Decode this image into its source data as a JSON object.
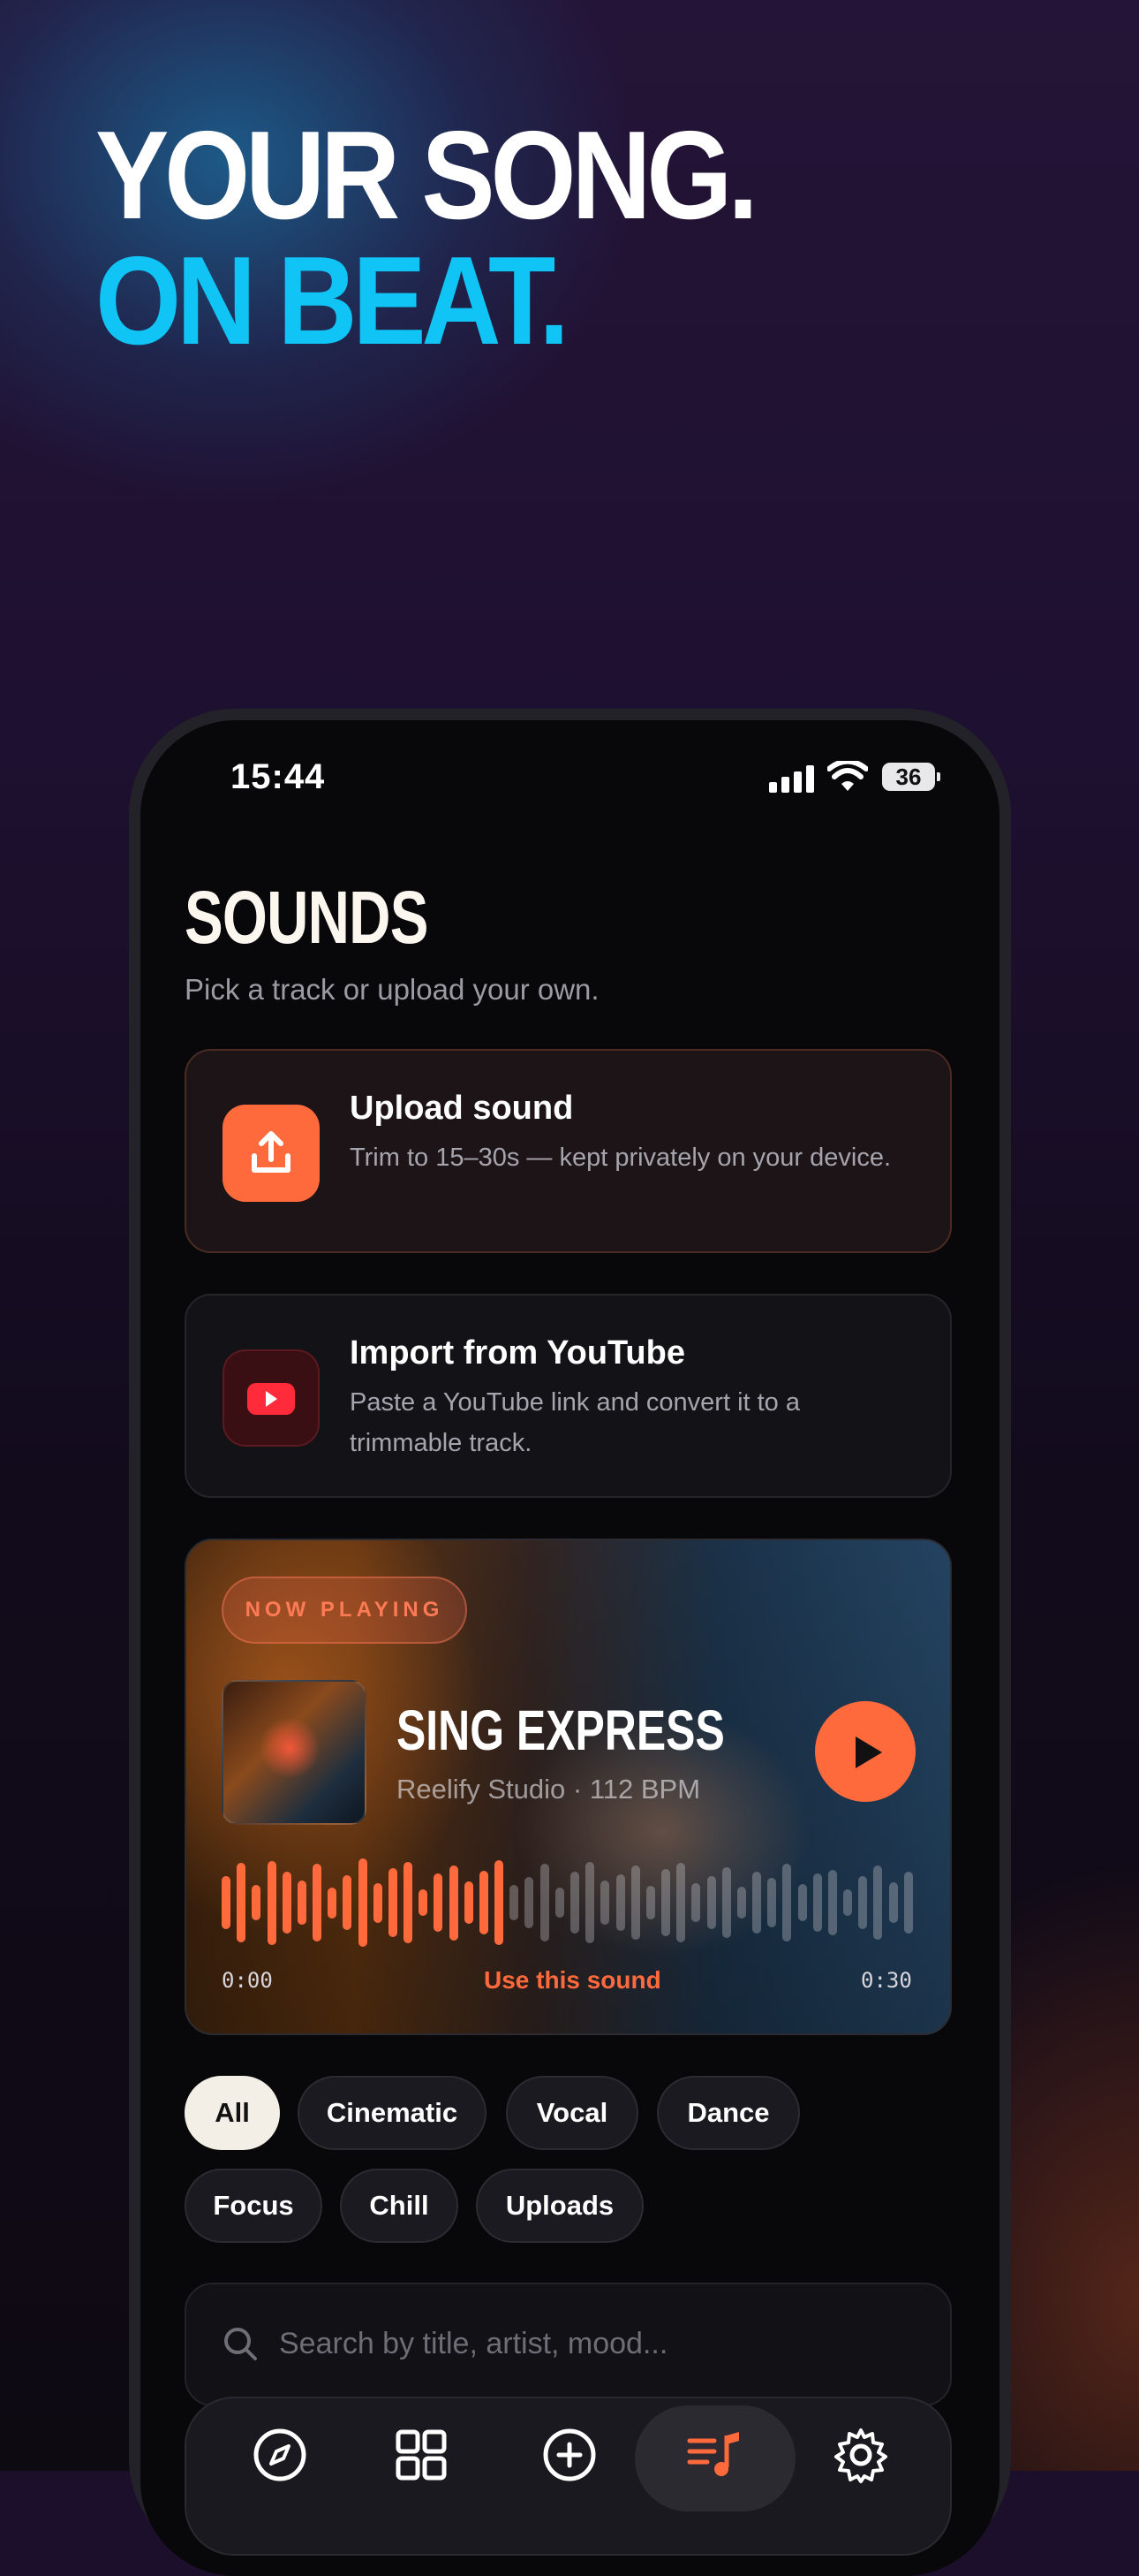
{
  "hero": {
    "line1": "YOUR SONG.",
    "line2": "ON BEAT."
  },
  "status_bar": {
    "time": "15:44",
    "battery": "36"
  },
  "page": {
    "title": "SOUNDS",
    "subtitle": "Pick a track or upload your own."
  },
  "upload_card": {
    "title": "Upload sound",
    "description": "Trim to 15–30s — kept privately on your device.",
    "icon": "upload-icon"
  },
  "youtube_card": {
    "title": "Import from YouTube",
    "description": "Paste a YouTube link and convert it to a trimmable track.",
    "icon": "youtube-icon"
  },
  "now_playing": {
    "badge": "NOW PLAYING",
    "title": "SING EXPRESS",
    "meta": "Reelify Studio · 112 BPM",
    "time_start": "0:00",
    "time_end": "0:30",
    "action": "Use this sound",
    "progress": 0.4
  },
  "filters": [
    "All",
    "Cinematic",
    "Vocal",
    "Dance",
    "Focus",
    "Chill",
    "Uploads"
  ],
  "active_filter": "All",
  "search": {
    "placeholder": "Search by title, artist, mood..."
  },
  "tab_bar": {
    "tabs": [
      "compass-icon",
      "grid-icon",
      "plus-circle-icon",
      "music-list-icon",
      "gear-icon"
    ],
    "active": "music-list-icon"
  },
  "colors": {
    "accent": "#ff6a3d",
    "headline_blue": "#10c4f5",
    "background": "#08080b"
  }
}
